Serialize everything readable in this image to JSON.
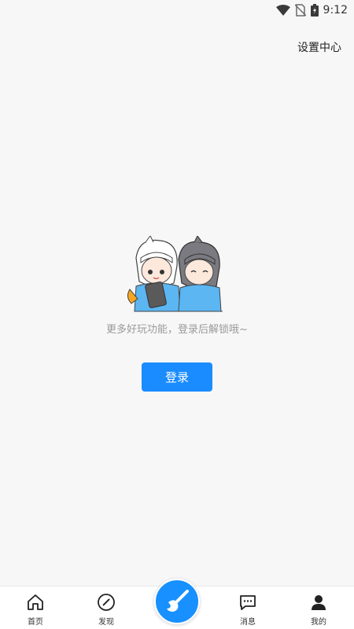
{
  "status_bar": {
    "time": "9:12",
    "icons": [
      "wifi-icon",
      "no-sim-icon",
      "battery-charging-icon"
    ]
  },
  "header": {
    "settings_label": "设置中心"
  },
  "empty_state": {
    "message": "更多好玩功能，登录后解锁哦~",
    "login_label": "登录",
    "illustration": "two-anime-characters-illustration"
  },
  "tab_bar": {
    "tabs": [
      {
        "label": "首页",
        "icon": "home-icon"
      },
      {
        "label": "发现",
        "icon": "compass-icon"
      },
      {
        "label": "",
        "icon": "brush-icon"
      },
      {
        "label": "消息",
        "icon": "message-icon"
      },
      {
        "label": "我的",
        "icon": "user-icon"
      }
    ]
  },
  "colors": {
    "accent": "#1a8cff",
    "background": "#f7f7f7",
    "hint_text": "#9a9a9a"
  }
}
